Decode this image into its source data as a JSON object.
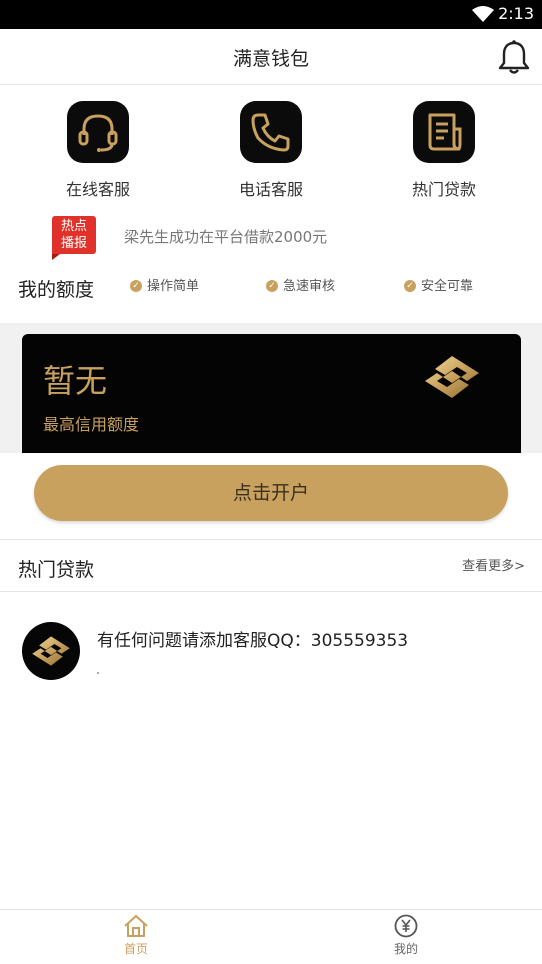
{
  "status_bar": {
    "time": "2:13"
  },
  "header": {
    "title": "满意钱包"
  },
  "quick_actions": [
    {
      "label": "在线客服",
      "icon": "headset-icon"
    },
    {
      "label": "电话客服",
      "icon": "phone-icon"
    },
    {
      "label": "热门贷款",
      "icon": "document-icon"
    }
  ],
  "news": {
    "badge_line1": "热点",
    "badge_line2": "播报",
    "text": "梁先生成功在平台借款2000元"
  },
  "quota": {
    "title": "我的额度",
    "features": [
      "操作简单",
      "急速审核",
      "安全可靠"
    ]
  },
  "card": {
    "amount": "暂无",
    "subtitle": "最高信用额度"
  },
  "open_button": {
    "label": "点击开户"
  },
  "hot_loans": {
    "title": "热门贷款",
    "more": "查看更多>"
  },
  "support": {
    "message": "有任何问题请添加客服QQ：305559353"
  },
  "tabbar": {
    "items": [
      {
        "label": "首页",
        "icon": "home-icon",
        "active": true
      },
      {
        "label": "我的",
        "icon": "yuan-icon",
        "active": false
      }
    ]
  },
  "colors": {
    "gold": "#c9a15e",
    "dark": "#040404",
    "badge_red": "#e0322a"
  }
}
